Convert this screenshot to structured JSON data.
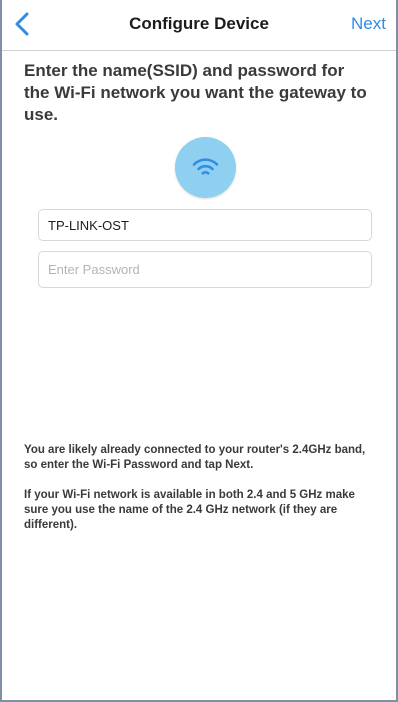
{
  "nav": {
    "title": "Configure Device",
    "next_label": "Next",
    "back_icon": "chevron-left-icon"
  },
  "heading": "Enter the name(SSID) and password for the Wi-Fi network you want the gateway to use.",
  "wifi_icon": {
    "name": "wifi-icon",
    "circle_color": "#8fd0f0",
    "icon_color": "#2f8de4"
  },
  "form": {
    "ssid_value": "TP-LINK-OST",
    "password_value": "",
    "password_placeholder": "Enter Password"
  },
  "info": {
    "paragraph_1": "You are likely already connected to your router's 2.4GHz band, so enter the Wi-Fi Password and tap Next.",
    "paragraph_2": "If your Wi-Fi network is available in both 2.4 and 5 GHz make sure you use the name of the 2.4 GHz network (if they are different)."
  },
  "colors": {
    "accent": "#2f8de4",
    "text": "#3a3a3c"
  }
}
